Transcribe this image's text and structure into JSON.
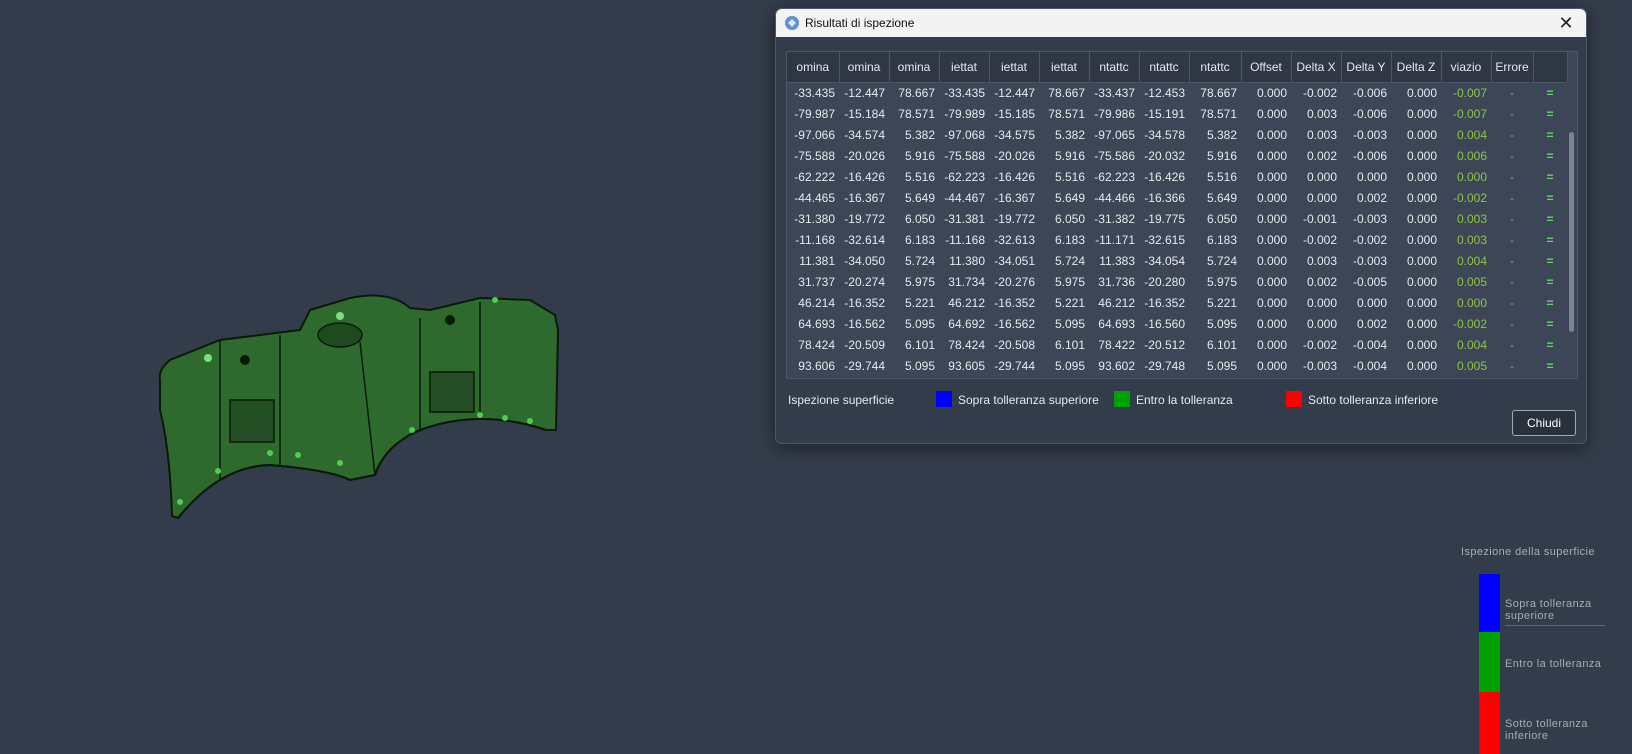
{
  "dialog": {
    "title": "Risultati di ispezione",
    "close_icon": "close-icon",
    "close_button_label": "Chiudi"
  },
  "table": {
    "columns": [
      "omina",
      "omina",
      "omina",
      "iettat",
      "iettat",
      "iettat",
      "ntattc",
      "ntattc",
      "ntattc",
      "Offset",
      "Delta X",
      "Delta Y",
      "Delta Z",
      "viazio",
      "Errore",
      ""
    ],
    "rows": [
      [
        "-33.435",
        "-12.447",
        "78.667",
        "-33.435",
        "-12.447",
        "78.667",
        "-33.437",
        "-12.453",
        "78.667",
        "0.000",
        "-0.002",
        "-0.006",
        "0.000",
        "-0.007",
        "-",
        "="
      ],
      [
        "-79.987",
        "-15.184",
        "78.571",
        "-79.989",
        "-15.185",
        "78.571",
        "-79.986",
        "-15.191",
        "78.571",
        "0.000",
        "0.003",
        "-0.006",
        "0.000",
        "-0.007",
        "-",
        "="
      ],
      [
        "-97.066",
        "-34.574",
        "5.382",
        "-97.068",
        "-34.575",
        "5.382",
        "-97.065",
        "-34.578",
        "5.382",
        "0.000",
        "0.003",
        "-0.003",
        "0.000",
        "0.004",
        "-",
        "="
      ],
      [
        "-75.588",
        "-20.026",
        "5.916",
        "-75.588",
        "-20.026",
        "5.916",
        "-75.586",
        "-20.032",
        "5.916",
        "0.000",
        "0.002",
        "-0.006",
        "0.000",
        "0.006",
        "-",
        "="
      ],
      [
        "-62.222",
        "-16.426",
        "5.516",
        "-62.223",
        "-16.426",
        "5.516",
        "-62.223",
        "-16.426",
        "5.516",
        "0.000",
        "0.000",
        "0.000",
        "0.000",
        "0.000",
        "-",
        "="
      ],
      [
        "-44.465",
        "-16.367",
        "5.649",
        "-44.467",
        "-16.367",
        "5.649",
        "-44.466",
        "-16.366",
        "5.649",
        "0.000",
        "0.000",
        "0.002",
        "0.000",
        "-0.002",
        "-",
        "="
      ],
      [
        "-31.380",
        "-19.772",
        "6.050",
        "-31.381",
        "-19.772",
        "6.050",
        "-31.382",
        "-19.775",
        "6.050",
        "0.000",
        "-0.001",
        "-0.003",
        "0.000",
        "0.003",
        "-",
        "="
      ],
      [
        "-11.168",
        "-32.614",
        "6.183",
        "-11.168",
        "-32.613",
        "6.183",
        "-11.171",
        "-32.615",
        "6.183",
        "0.000",
        "-0.002",
        "-0.002",
        "0.000",
        "0.003",
        "-",
        "="
      ],
      [
        "11.381",
        "-34.050",
        "5.724",
        "11.380",
        "-34.051",
        "5.724",
        "11.383",
        "-34.054",
        "5.724",
        "0.000",
        "0.003",
        "-0.003",
        "0.000",
        "0.004",
        "-",
        "="
      ],
      [
        "31.737",
        "-20.274",
        "5.975",
        "31.734",
        "-20.276",
        "5.975",
        "31.736",
        "-20.280",
        "5.975",
        "0.000",
        "0.002",
        "-0.005",
        "0.000",
        "0.005",
        "-",
        "="
      ],
      [
        "46.214",
        "-16.352",
        "5.221",
        "46.212",
        "-16.352",
        "5.221",
        "46.212",
        "-16.352",
        "5.221",
        "0.000",
        "0.000",
        "0.000",
        "0.000",
        "0.000",
        "-",
        "="
      ],
      [
        "64.693",
        "-16.562",
        "5.095",
        "64.692",
        "-16.562",
        "5.095",
        "64.693",
        "-16.560",
        "5.095",
        "0.000",
        "0.000",
        "0.002",
        "0.000",
        "-0.002",
        "-",
        "="
      ],
      [
        "78.424",
        "-20.509",
        "6.101",
        "78.424",
        "-20.508",
        "6.101",
        "78.422",
        "-20.512",
        "6.101",
        "0.000",
        "-0.002",
        "-0.004",
        "0.000",
        "0.004",
        "-",
        "="
      ],
      [
        "93.606",
        "-29.744",
        "5.095",
        "93.605",
        "-29.744",
        "5.095",
        "93.602",
        "-29.748",
        "5.095",
        "0.000",
        "-0.003",
        "-0.004",
        "0.000",
        "0.005",
        "-",
        "="
      ]
    ]
  },
  "legend": {
    "title": "Ispezione superficie",
    "items": [
      {
        "label": "Sopra tolleranza superiore",
        "color": "#0000ff"
      },
      {
        "label": "Entro la tolleranza",
        "color": "#00a000"
      },
      {
        "label": "Sotto tolleranza inferiore",
        "color": "#ff0000"
      }
    ]
  },
  "side_legend": {
    "title": "Ispezione della superficie",
    "items": [
      {
        "label": "Sopra tolleranza superiore",
        "color": "#0000ff"
      },
      {
        "label": "Entro la tolleranza",
        "color": "#00a000"
      },
      {
        "label": "Sotto tolleranza inferiore",
        "color": "#ff0000"
      }
    ]
  },
  "colors": {
    "background": "#333c4a",
    "deviation_text": "#8fc441",
    "status_text": "#5fd65f",
    "model_green": "#2e6a2e"
  }
}
